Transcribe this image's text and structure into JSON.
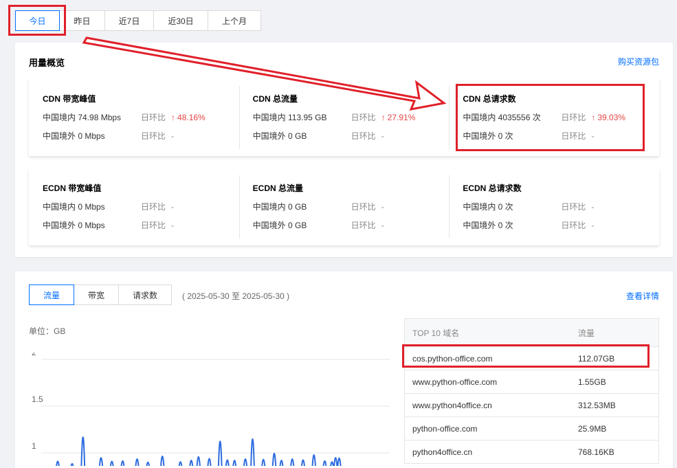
{
  "date_tabs": [
    "今日",
    "昨日",
    "近7日",
    "近30日",
    "上个月"
  ],
  "overview": {
    "title": "用量概览",
    "buy_link": "购买资源包",
    "cdn": [
      {
        "title": "CDN 带宽峰值",
        "domestic": "中国境内 74.98 Mbps",
        "overseas": "中国境外 0 Mbps",
        "cmp_label": "日环比",
        "domestic_change": "48.16%",
        "overseas_change": "-"
      },
      {
        "title": "CDN 总流量",
        "domestic": "中国境内 113.95 GB",
        "overseas": "中国境外 0 GB",
        "cmp_label": "日环比",
        "domestic_change": "27.91%",
        "overseas_change": "-"
      },
      {
        "title": "CDN 总请求数",
        "domestic": "中国境内 4035556 次",
        "overseas": "中国境外 0 次",
        "cmp_label": "日环比",
        "domestic_change": "39.03%",
        "overseas_change": "-"
      }
    ],
    "ecdn": [
      {
        "title": "ECDN 带宽峰值",
        "domestic": "中国境内 0 Mbps",
        "overseas": "中国境外 0 Mbps",
        "cmp_label": "日环比",
        "domestic_change": "-",
        "overseas_change": "-"
      },
      {
        "title": "ECDN 总流量",
        "domestic": "中国境内 0 GB",
        "overseas": "中国境外 0 GB",
        "cmp_label": "日环比",
        "domestic_change": "-",
        "overseas_change": "-"
      },
      {
        "title": "ECDN 总请求数",
        "domestic": "中国境内 0 次",
        "overseas": "中国境外 0 次",
        "cmp_label": "日环比",
        "domestic_change": "-",
        "overseas_change": "-"
      }
    ]
  },
  "detail": {
    "tabs": [
      "流量",
      "带宽",
      "请求数"
    ],
    "range": "( 2025-05-30 至 2025-05-30 )",
    "view_link": "查看详情",
    "unit": "单位：GB",
    "top10": {
      "col_domain": "TOP 10 域名",
      "col_traffic": "流量",
      "rows": [
        {
          "domain": "cos.python-office.com",
          "traffic": "112.07GB"
        },
        {
          "domain": "www.python-office.com",
          "traffic": "1.55GB"
        },
        {
          "domain": "www.python4office.cn",
          "traffic": "312.53MB"
        },
        {
          "domain": "python-office.com",
          "traffic": "25.9MB"
        },
        {
          "domain": "python4office.cn",
          "traffic": "768.16KB"
        }
      ]
    }
  },
  "chart_data": {
    "type": "line",
    "title": "",
    "xlabel": "",
    "ylabel": "单位：GB",
    "ylim": [
      0.8,
      2
    ],
    "y_ticks": [
      2,
      1.5,
      1
    ],
    "x": [
      8,
      12,
      15,
      20,
      23,
      26,
      30,
      33,
      37,
      42,
      45,
      47,
      50,
      53,
      55,
      57,
      60,
      62,
      65,
      68,
      70,
      73,
      76,
      79,
      82,
      84,
      85,
      86
    ],
    "values": [
      0.95,
      0.9,
      1.47,
      1.03,
      0.95,
      0.96,
      1.0,
      0.93,
      1.06,
      0.94,
      0.97,
      1.05,
      1.01,
      1.38,
      0.98,
      0.97,
      1.0,
      1.43,
      0.99,
      1.12,
      0.97,
      1.0,
      0.98,
      1.09,
      0.96,
      0.94,
      1.03,
      1.02
    ],
    "color": "#2d6cdf",
    "grid": true
  },
  "colors": {
    "accent": "#006eff",
    "up": "#e54545",
    "annotation": "#e0202a"
  }
}
